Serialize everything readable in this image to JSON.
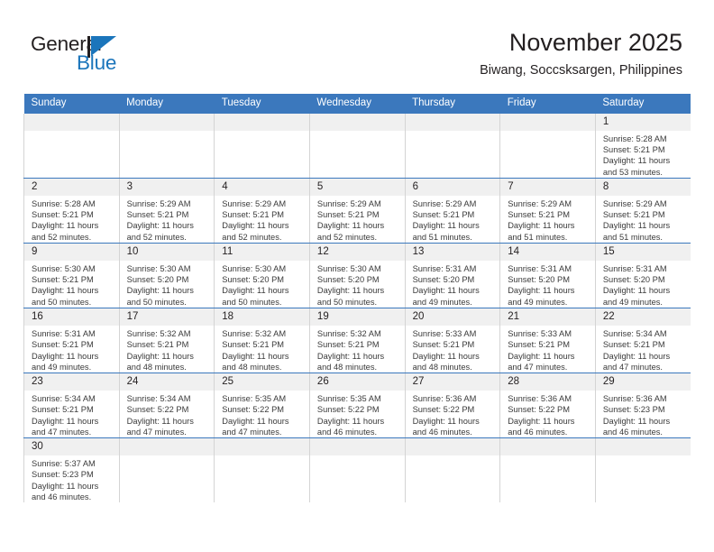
{
  "logo": {
    "word_top": "General",
    "word_bottom": "Blue",
    "triangle_color": "#1b75bb",
    "text_color": "#231f20"
  },
  "header": {
    "title": "November 2025",
    "subtitle": "Biwang, Soccsksargen, Philippines"
  },
  "theme": {
    "header_blue": "#3b78bd",
    "daynum_bg": "#f0f0f0",
    "grid_line": "#d4d4d4",
    "text": "#231f20"
  },
  "calendar": {
    "weekday_headers": [
      "Sunday",
      "Monday",
      "Tuesday",
      "Wednesday",
      "Thursday",
      "Friday",
      "Saturday"
    ],
    "labels": {
      "sunrise": "Sunrise:",
      "sunset": "Sunset:",
      "daylight": "Daylight:"
    },
    "weeks": [
      [
        {
          "day": "",
          "blank": true
        },
        {
          "day": "",
          "blank": true
        },
        {
          "day": "",
          "blank": true
        },
        {
          "day": "",
          "blank": true
        },
        {
          "day": "",
          "blank": true
        },
        {
          "day": "",
          "blank": true
        },
        {
          "day": "1",
          "sunrise": "Sunrise: 5:28 AM",
          "sunset": "Sunset: 5:21 PM",
          "daylight": "Daylight: 11 hours and 53 minutes."
        }
      ],
      [
        {
          "day": "2",
          "sunrise": "Sunrise: 5:28 AM",
          "sunset": "Sunset: 5:21 PM",
          "daylight": "Daylight: 11 hours and 52 minutes."
        },
        {
          "day": "3",
          "sunrise": "Sunrise: 5:29 AM",
          "sunset": "Sunset: 5:21 PM",
          "daylight": "Daylight: 11 hours and 52 minutes."
        },
        {
          "day": "4",
          "sunrise": "Sunrise: 5:29 AM",
          "sunset": "Sunset: 5:21 PM",
          "daylight": "Daylight: 11 hours and 52 minutes."
        },
        {
          "day": "5",
          "sunrise": "Sunrise: 5:29 AM",
          "sunset": "Sunset: 5:21 PM",
          "daylight": "Daylight: 11 hours and 52 minutes."
        },
        {
          "day": "6",
          "sunrise": "Sunrise: 5:29 AM",
          "sunset": "Sunset: 5:21 PM",
          "daylight": "Daylight: 11 hours and 51 minutes."
        },
        {
          "day": "7",
          "sunrise": "Sunrise: 5:29 AM",
          "sunset": "Sunset: 5:21 PM",
          "daylight": "Daylight: 11 hours and 51 minutes."
        },
        {
          "day": "8",
          "sunrise": "Sunrise: 5:29 AM",
          "sunset": "Sunset: 5:21 PM",
          "daylight": "Daylight: 11 hours and 51 minutes."
        }
      ],
      [
        {
          "day": "9",
          "sunrise": "Sunrise: 5:30 AM",
          "sunset": "Sunset: 5:21 PM",
          "daylight": "Daylight: 11 hours and 50 minutes."
        },
        {
          "day": "10",
          "sunrise": "Sunrise: 5:30 AM",
          "sunset": "Sunset: 5:20 PM",
          "daylight": "Daylight: 11 hours and 50 minutes."
        },
        {
          "day": "11",
          "sunrise": "Sunrise: 5:30 AM",
          "sunset": "Sunset: 5:20 PM",
          "daylight": "Daylight: 11 hours and 50 minutes."
        },
        {
          "day": "12",
          "sunrise": "Sunrise: 5:30 AM",
          "sunset": "Sunset: 5:20 PM",
          "daylight": "Daylight: 11 hours and 50 minutes."
        },
        {
          "day": "13",
          "sunrise": "Sunrise: 5:31 AM",
          "sunset": "Sunset: 5:20 PM",
          "daylight": "Daylight: 11 hours and 49 minutes."
        },
        {
          "day": "14",
          "sunrise": "Sunrise: 5:31 AM",
          "sunset": "Sunset: 5:20 PM",
          "daylight": "Daylight: 11 hours and 49 minutes."
        },
        {
          "day": "15",
          "sunrise": "Sunrise: 5:31 AM",
          "sunset": "Sunset: 5:20 PM",
          "daylight": "Daylight: 11 hours and 49 minutes."
        }
      ],
      [
        {
          "day": "16",
          "sunrise": "Sunrise: 5:31 AM",
          "sunset": "Sunset: 5:21 PM",
          "daylight": "Daylight: 11 hours and 49 minutes."
        },
        {
          "day": "17",
          "sunrise": "Sunrise: 5:32 AM",
          "sunset": "Sunset: 5:21 PM",
          "daylight": "Daylight: 11 hours and 48 minutes."
        },
        {
          "day": "18",
          "sunrise": "Sunrise: 5:32 AM",
          "sunset": "Sunset: 5:21 PM",
          "daylight": "Daylight: 11 hours and 48 minutes."
        },
        {
          "day": "19",
          "sunrise": "Sunrise: 5:32 AM",
          "sunset": "Sunset: 5:21 PM",
          "daylight": "Daylight: 11 hours and 48 minutes."
        },
        {
          "day": "20",
          "sunrise": "Sunrise: 5:33 AM",
          "sunset": "Sunset: 5:21 PM",
          "daylight": "Daylight: 11 hours and 48 minutes."
        },
        {
          "day": "21",
          "sunrise": "Sunrise: 5:33 AM",
          "sunset": "Sunset: 5:21 PM",
          "daylight": "Daylight: 11 hours and 47 minutes."
        },
        {
          "day": "22",
          "sunrise": "Sunrise: 5:34 AM",
          "sunset": "Sunset: 5:21 PM",
          "daylight": "Daylight: 11 hours and 47 minutes."
        }
      ],
      [
        {
          "day": "23",
          "sunrise": "Sunrise: 5:34 AM",
          "sunset": "Sunset: 5:21 PM",
          "daylight": "Daylight: 11 hours and 47 minutes."
        },
        {
          "day": "24",
          "sunrise": "Sunrise: 5:34 AM",
          "sunset": "Sunset: 5:22 PM",
          "daylight": "Daylight: 11 hours and 47 minutes."
        },
        {
          "day": "25",
          "sunrise": "Sunrise: 5:35 AM",
          "sunset": "Sunset: 5:22 PM",
          "daylight": "Daylight: 11 hours and 47 minutes."
        },
        {
          "day": "26",
          "sunrise": "Sunrise: 5:35 AM",
          "sunset": "Sunset: 5:22 PM",
          "daylight": "Daylight: 11 hours and 46 minutes."
        },
        {
          "day": "27",
          "sunrise": "Sunrise: 5:36 AM",
          "sunset": "Sunset: 5:22 PM",
          "daylight": "Daylight: 11 hours and 46 minutes."
        },
        {
          "day": "28",
          "sunrise": "Sunrise: 5:36 AM",
          "sunset": "Sunset: 5:22 PM",
          "daylight": "Daylight: 11 hours and 46 minutes."
        },
        {
          "day": "29",
          "sunrise": "Sunrise: 5:36 AM",
          "sunset": "Sunset: 5:23 PM",
          "daylight": "Daylight: 11 hours and 46 minutes."
        }
      ],
      [
        {
          "day": "30",
          "sunrise": "Sunrise: 5:37 AM",
          "sunset": "Sunset: 5:23 PM",
          "daylight": "Daylight: 11 hours and 46 minutes."
        },
        {
          "day": "",
          "blank": true
        },
        {
          "day": "",
          "blank": true
        },
        {
          "day": "",
          "blank": true
        },
        {
          "day": "",
          "blank": true
        },
        {
          "day": "",
          "blank": true
        },
        {
          "day": "",
          "blank": true
        }
      ]
    ]
  }
}
